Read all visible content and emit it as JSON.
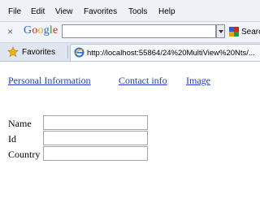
{
  "menu": {
    "items": [
      "File",
      "Edit",
      "View",
      "Favorites",
      "Tools",
      "Help"
    ]
  },
  "google_toolbar": {
    "close_glyph": "×",
    "logo_letters": [
      "G",
      "o",
      "o",
      "g",
      "l",
      "e"
    ],
    "search_value": "",
    "search_button_label": "Searc",
    "search_button_icon": "google-search-icon"
  },
  "favorites_bar": {
    "favorites_label": "Favorites",
    "favorites_icon": "star-icon",
    "tab_title": "http://localhost:55864/24%20MultiView%20Nts/...",
    "tab_icon": "ie-page-icon"
  },
  "page": {
    "nav_links": [
      "Personal Information",
      "Contact info",
      "Image"
    ],
    "form": {
      "name_label": "Name",
      "name_value": "",
      "id_label": "Id",
      "id_value": "",
      "country_label": "Country",
      "country_value": ""
    }
  },
  "colors": {
    "link": "#1f3bd2",
    "chrome_background": "#eef1f6",
    "favorites_bar_background": "#dfe6f0"
  }
}
